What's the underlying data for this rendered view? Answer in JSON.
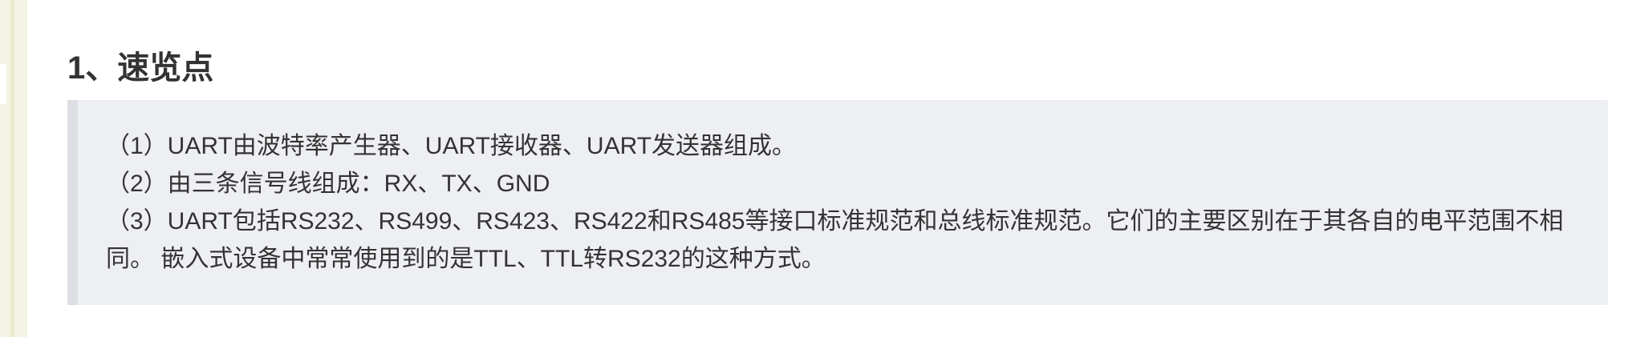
{
  "section": {
    "heading": "1、速览点",
    "quote_lines": [
      "（1）UART由波特率产生器、UART接收器、UART发送器组成。",
      "（2）由三条信号线组成：RX、TX、GND",
      "（3）UART包括RS232、RS499、RS423、RS422和RS485等接口标准规范和总线标准规范。它们的主要区别在于其各自的电平范围不相同。 嵌入式设备中常常使用到的是TTL、TTL转RS232的这种方式。"
    ]
  },
  "colors": {
    "text": "#333333",
    "quote_background": "#eeeff3",
    "quote_border": "#dddee3",
    "left_strip": "#f4f4e6"
  }
}
